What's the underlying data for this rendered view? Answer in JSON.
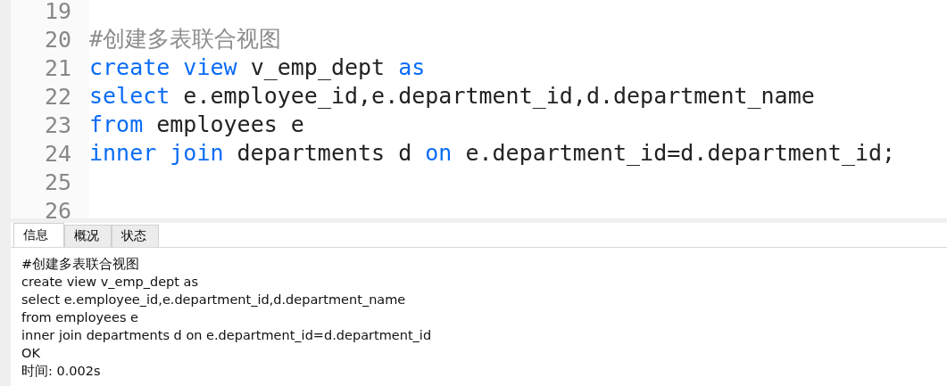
{
  "editor": {
    "lines": [
      {
        "number": "19"
      },
      {
        "number": "20",
        "tokens": [
          {
            "kind": "comment",
            "text": "#创建多表联合视图"
          }
        ]
      },
      {
        "number": "21",
        "tokens": [
          {
            "kind": "keyword",
            "text": "create view"
          },
          {
            "kind": "plain",
            "text": " v_emp_dept "
          },
          {
            "kind": "keyword",
            "text": "as"
          }
        ]
      },
      {
        "number": "22",
        "tokens": [
          {
            "kind": "keyword",
            "text": "select"
          },
          {
            "kind": "plain",
            "text": " e.employee_id,e.department_id,d.department_name"
          }
        ]
      },
      {
        "number": "23",
        "tokens": [
          {
            "kind": "keyword",
            "text": "from"
          },
          {
            "kind": "plain",
            "text": " employees e"
          }
        ]
      },
      {
        "number": "24",
        "tokens": [
          {
            "kind": "keyword",
            "text": "inner join"
          },
          {
            "kind": "plain",
            "text": " departments d "
          },
          {
            "kind": "keyword",
            "text": "on"
          },
          {
            "kind": "plain",
            "text": " e.department_id=d.department_id;"
          }
        ]
      },
      {
        "number": "25"
      },
      {
        "number": "26"
      }
    ]
  },
  "tabs": [
    {
      "label": "信息",
      "selected": true
    },
    {
      "label": "概况",
      "selected": false
    },
    {
      "label": "状态",
      "selected": false
    }
  ],
  "messages": [
    "#创建多表联合视图",
    "create view v_emp_dept as",
    "select e.employee_id,e.department_id,d.department_name",
    "from employees e",
    "inner join departments d on e.department_id=d.department_id",
    "OK",
    "时间: 0.002s"
  ]
}
